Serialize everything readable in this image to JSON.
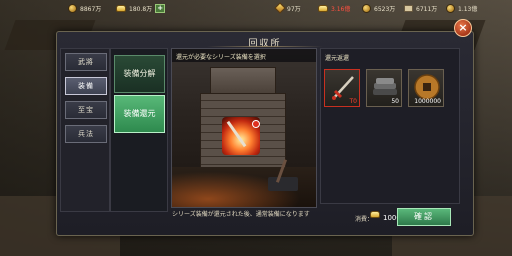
{
  "top": {
    "res1_value": "8867万",
    "res2_value": "180.8万",
    "add_label": "+",
    "res3_value": "97万",
    "res4_value": "3.16億",
    "res5_value": "6523万",
    "res6_value": "6711万",
    "res7_value": "1.13億"
  },
  "panel": {
    "title": "回収所",
    "close_label": "×"
  },
  "tabs": [
    {
      "label": "武將"
    },
    {
      "label": "装備"
    },
    {
      "label": "至宝"
    },
    {
      "label": "兵法"
    }
  ],
  "subtabs": [
    {
      "label": "装備分解"
    },
    {
      "label": "装備還元"
    }
  ],
  "scene": {
    "header": "還元が必要なシリーズ装備を選択",
    "sword_level": "T0"
  },
  "preview": {
    "header": "還元返還",
    "items": [
      {
        "name": "sword",
        "count": "T0"
      },
      {
        "name": "material-bundle",
        "count": "50"
      },
      {
        "name": "copper-coin",
        "count": "1000000"
      }
    ]
  },
  "footer": {
    "info": "シリーズ装備が還元された後、通常装備になります",
    "cost_label": "消費：",
    "cost_value": "1000",
    "confirm_label": "確認"
  },
  "colors": {
    "accent_green": "#2e8a4e",
    "close_red": "#a8381a",
    "panel_bg": "#1e1e26"
  }
}
